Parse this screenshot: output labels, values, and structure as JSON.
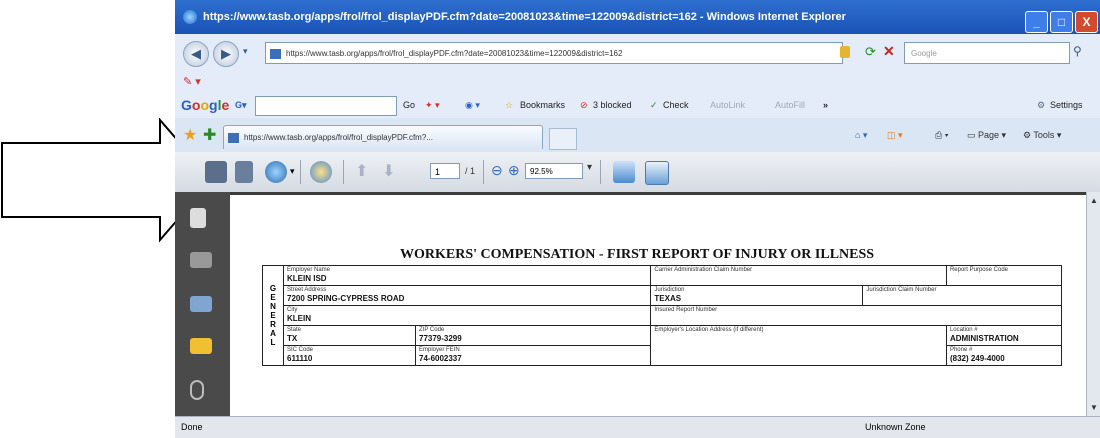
{
  "window": {
    "title": "https://www.tasb.org/apps/frol/frol_displayPDF.cfm?date=20081023&time=122009&district=162 - Windows Internet Explorer",
    "buttons": [
      "_",
      "□",
      "X"
    ]
  },
  "address_bar": {
    "url": "https://www.tasb.org/apps/frol/frol_displayPDF.cfm?date=20081023&time=122009&district=162",
    "search_placeholder": "Google"
  },
  "google_toolbar": {
    "logo_letters": [
      "G",
      "o",
      "o",
      "g",
      "l",
      "e"
    ],
    "search_button": "Go",
    "bookmarks": "Bookmarks",
    "blocked": "3 blocked",
    "check": "Check",
    "autolink": "AutoLink",
    "autofill": "AutoFill",
    "more": "»",
    "settings": "Settings"
  },
  "tab_bar": {
    "tab_title": "https://www.tasb.org/apps/frol/frol_displayPDF.cfm?...",
    "page_menu": "Page",
    "tools_menu": "Tools"
  },
  "pdf_toolbar": {
    "current_page": "1",
    "total_pages": "/ 1",
    "zoom": "92.5%"
  },
  "form": {
    "title": "WORKERS' COMPENSATION - FIRST REPORT OF INJURY OR ILLNESS",
    "section_letters": [
      "G",
      "E",
      "N",
      "E",
      "R",
      "A",
      "L"
    ],
    "employer_name_label": "Employer Name",
    "employer_name": "KLEIN ISD",
    "carrier_claim_label": "Carrier Administration Claim Number",
    "report_purpose_label": "Report Purpose Code",
    "street_label": "Street Address",
    "street": "7200 SPRING-CYPRESS ROAD",
    "jurisdiction_label": "Jurisdiction",
    "jurisdiction": "TEXAS",
    "jurisdiction_claim_label": "Jurisdiction Claim Number",
    "city_label": "City",
    "city": "KLEIN",
    "insured_report_label": "Insured Report Number",
    "state_label": "State",
    "state": "TX",
    "zip_label": "ZIP Code",
    "zip": "77379-3299",
    "location_address_label": "Employer's Location Address (if different)",
    "location_label": "Location #",
    "location": "ADMINISTRATION",
    "sic_label": "SIC Code",
    "sic": "611110",
    "fein_label": "Employer FEIN",
    "fein": "74-6002337",
    "phone_label": "Phone #",
    "phone": "(832) 249-4000"
  },
  "status_bar": {
    "left": "Done",
    "zone": "Unknown Zone"
  }
}
